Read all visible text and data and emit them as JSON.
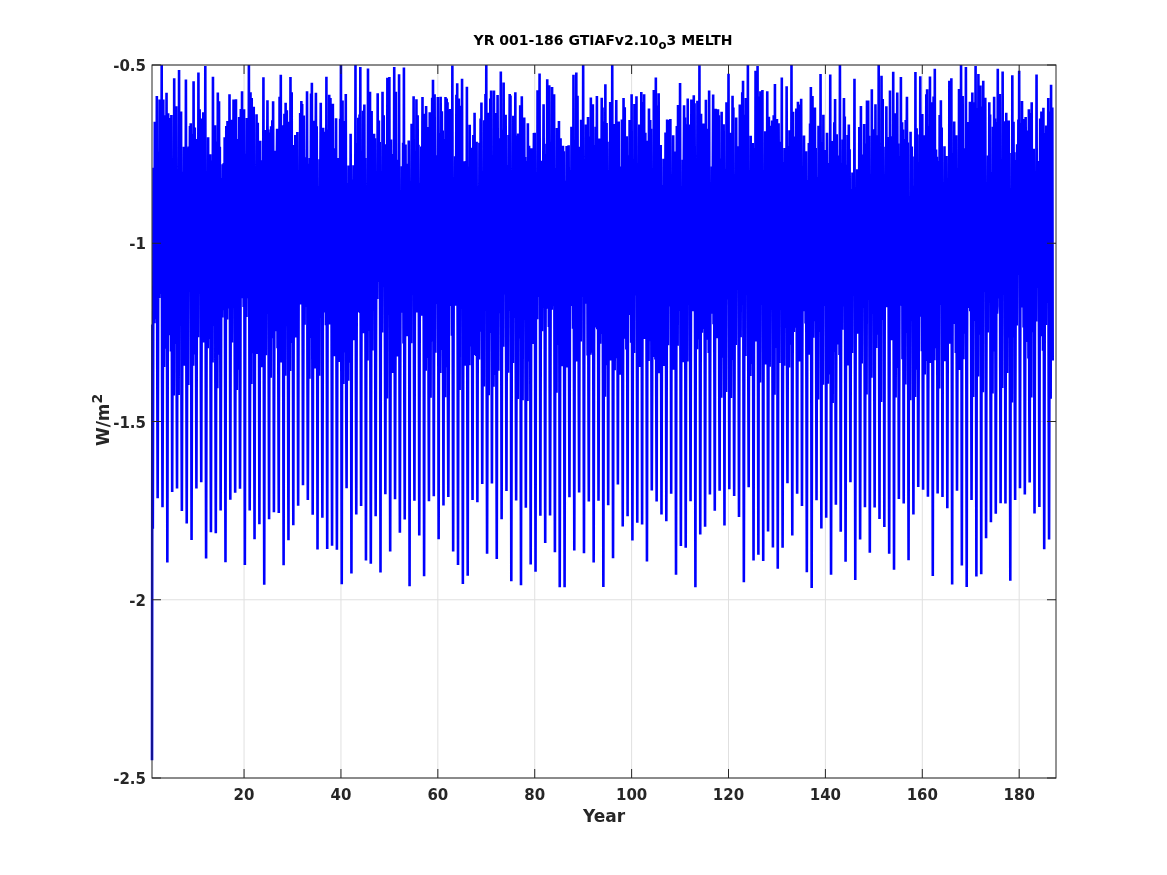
{
  "figure": {
    "title": "YR 001-186 GTIAFv2.10$_{o}$3 MELTH",
    "xlabel": "Year",
    "ylabel": "W/m$^{2}$",
    "xticks": [
      "20",
      "40",
      "60",
      "80",
      "100",
      "120",
      "140",
      "160",
      "180"
    ],
    "yticks": [
      "-0.5",
      "-1",
      "-1.5",
      "-2",
      "-2.5"
    ]
  }
}
